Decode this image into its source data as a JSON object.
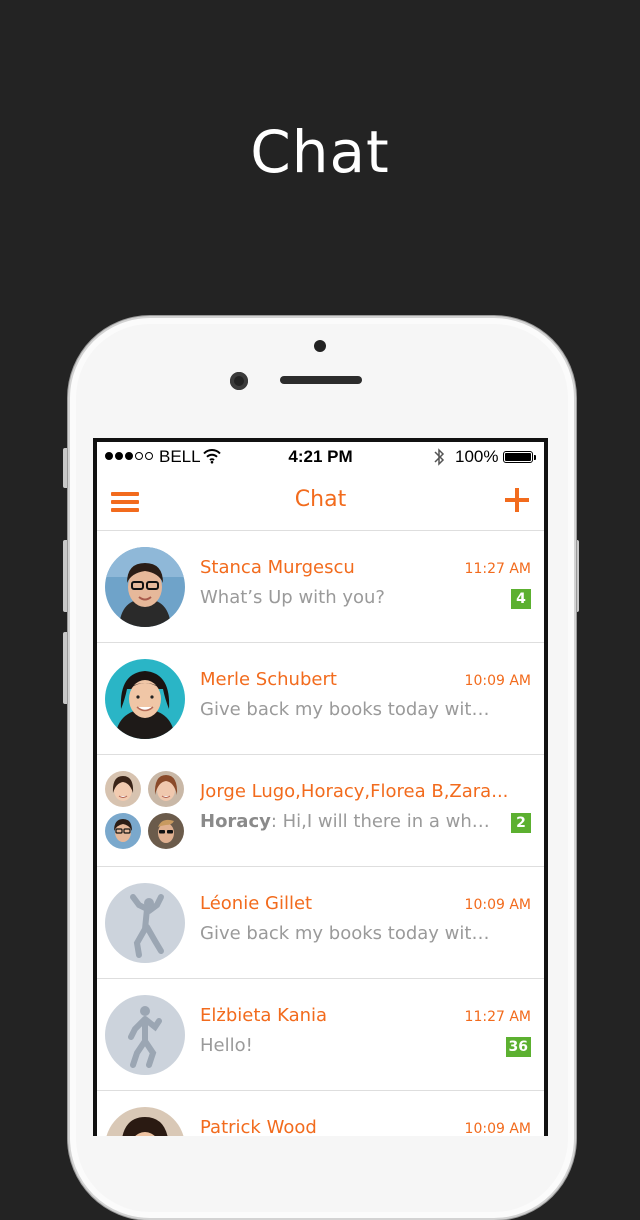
{
  "hero": {
    "title": "Chat"
  },
  "status_bar": {
    "signal": [
      true,
      true,
      true,
      false,
      false
    ],
    "carrier": "BELL",
    "time": "4:21 PM",
    "battery": "100%"
  },
  "nav": {
    "title": "Chat"
  },
  "colors": {
    "accent": "#f26b1d",
    "badge": "#5cb030",
    "background": "#232323"
  },
  "chats": [
    {
      "name": "Stanca Murgescu",
      "time": "11:27 AM",
      "preview": "What’s Up with you?",
      "badge": "4",
      "avatar": "photo"
    },
    {
      "name": "Merle Schubert",
      "time": "10:09 AM",
      "preview": "Give back my books today with...",
      "badge": "",
      "avatar": "photo"
    },
    {
      "name": "Jorge Lugo,Horacy,Florea B,Zara...",
      "time": "",
      "sender": "Horacy",
      "preview": ": Hi,I will there in a while...",
      "badge": "2",
      "avatar": "group"
    },
    {
      "name": "Léonie Gillet",
      "time": "10:09 AM",
      "preview": "Give back my books today with...",
      "badge": "",
      "avatar": "placeholder"
    },
    {
      "name": "Elżbieta Kania",
      "time": "11:27 AM",
      "preview": "Hello!",
      "badge": "36",
      "avatar": "placeholder"
    },
    {
      "name": "Patrick Wood",
      "time": "10:09 AM",
      "preview": "",
      "badge": "",
      "avatar": "photo"
    }
  ]
}
